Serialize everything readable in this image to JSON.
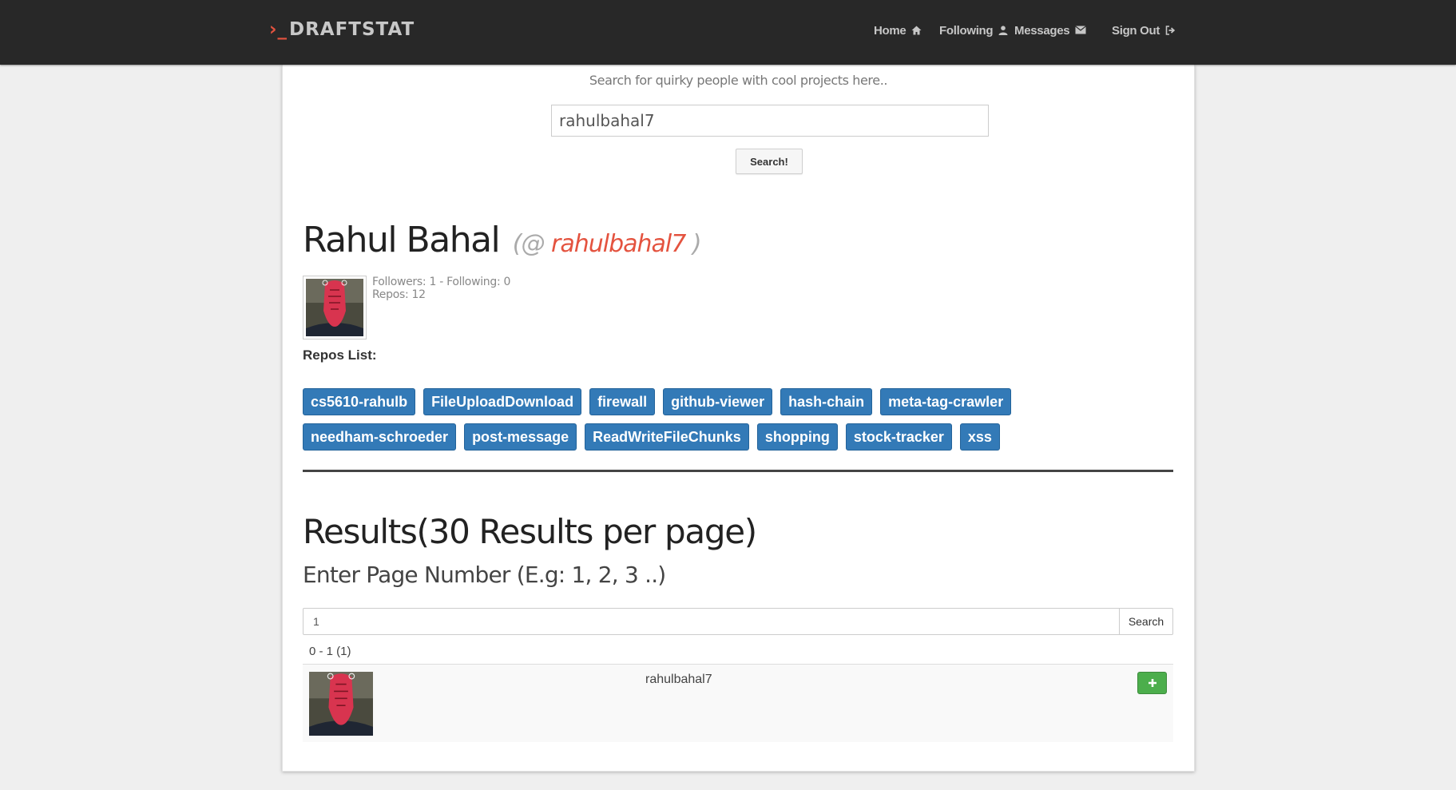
{
  "navbar": {
    "brand_prompt": "›_",
    "brand_name": "DRAFTSTAT",
    "links": [
      {
        "label": "Home",
        "icon": "home-icon"
      },
      {
        "label": "Following",
        "icon": "user-icon"
      },
      {
        "label": "Messages",
        "icon": "envelope-icon"
      },
      {
        "label": "Sign Out",
        "icon": "sign-out-icon"
      }
    ]
  },
  "search": {
    "tagline": "Search for quirky people with cool projects here..",
    "value": "rahulbahal7",
    "button_label": "Search!"
  },
  "profile": {
    "name": "Rahul Bahal",
    "handle_open": "(@ ",
    "handle": "rahulbahal7",
    "handle_close": " )",
    "stats_line1": "Followers: 1 - Following: 0",
    "stats_line2": "Repos: 12",
    "repos_title": "Repos List:",
    "repos_row1": [
      "cs5610-rahulb",
      "FileUploadDownload",
      "firewall",
      "github-viewer",
      "hash-chain",
      "meta-tag-crawler"
    ],
    "repos_row2": [
      "needham-schroeder",
      "post-message",
      "ReadWriteFileChunks",
      "shopping",
      "stock-tracker",
      "xss"
    ]
  },
  "results": {
    "title": "Results(30 Results per page)",
    "page_label": "Enter Page Number (E.g: 1, 2, 3 ..)",
    "page_value": "1",
    "page_button": "Search",
    "range": "0 - 1 (1)",
    "rows": [
      {
        "username": "rahulbahal7"
      }
    ]
  },
  "colors": {
    "navbar_bg": "#282828",
    "accent": "#e4533f",
    "repo_button": "#337ab7",
    "follow_button": "#4cae4c"
  }
}
